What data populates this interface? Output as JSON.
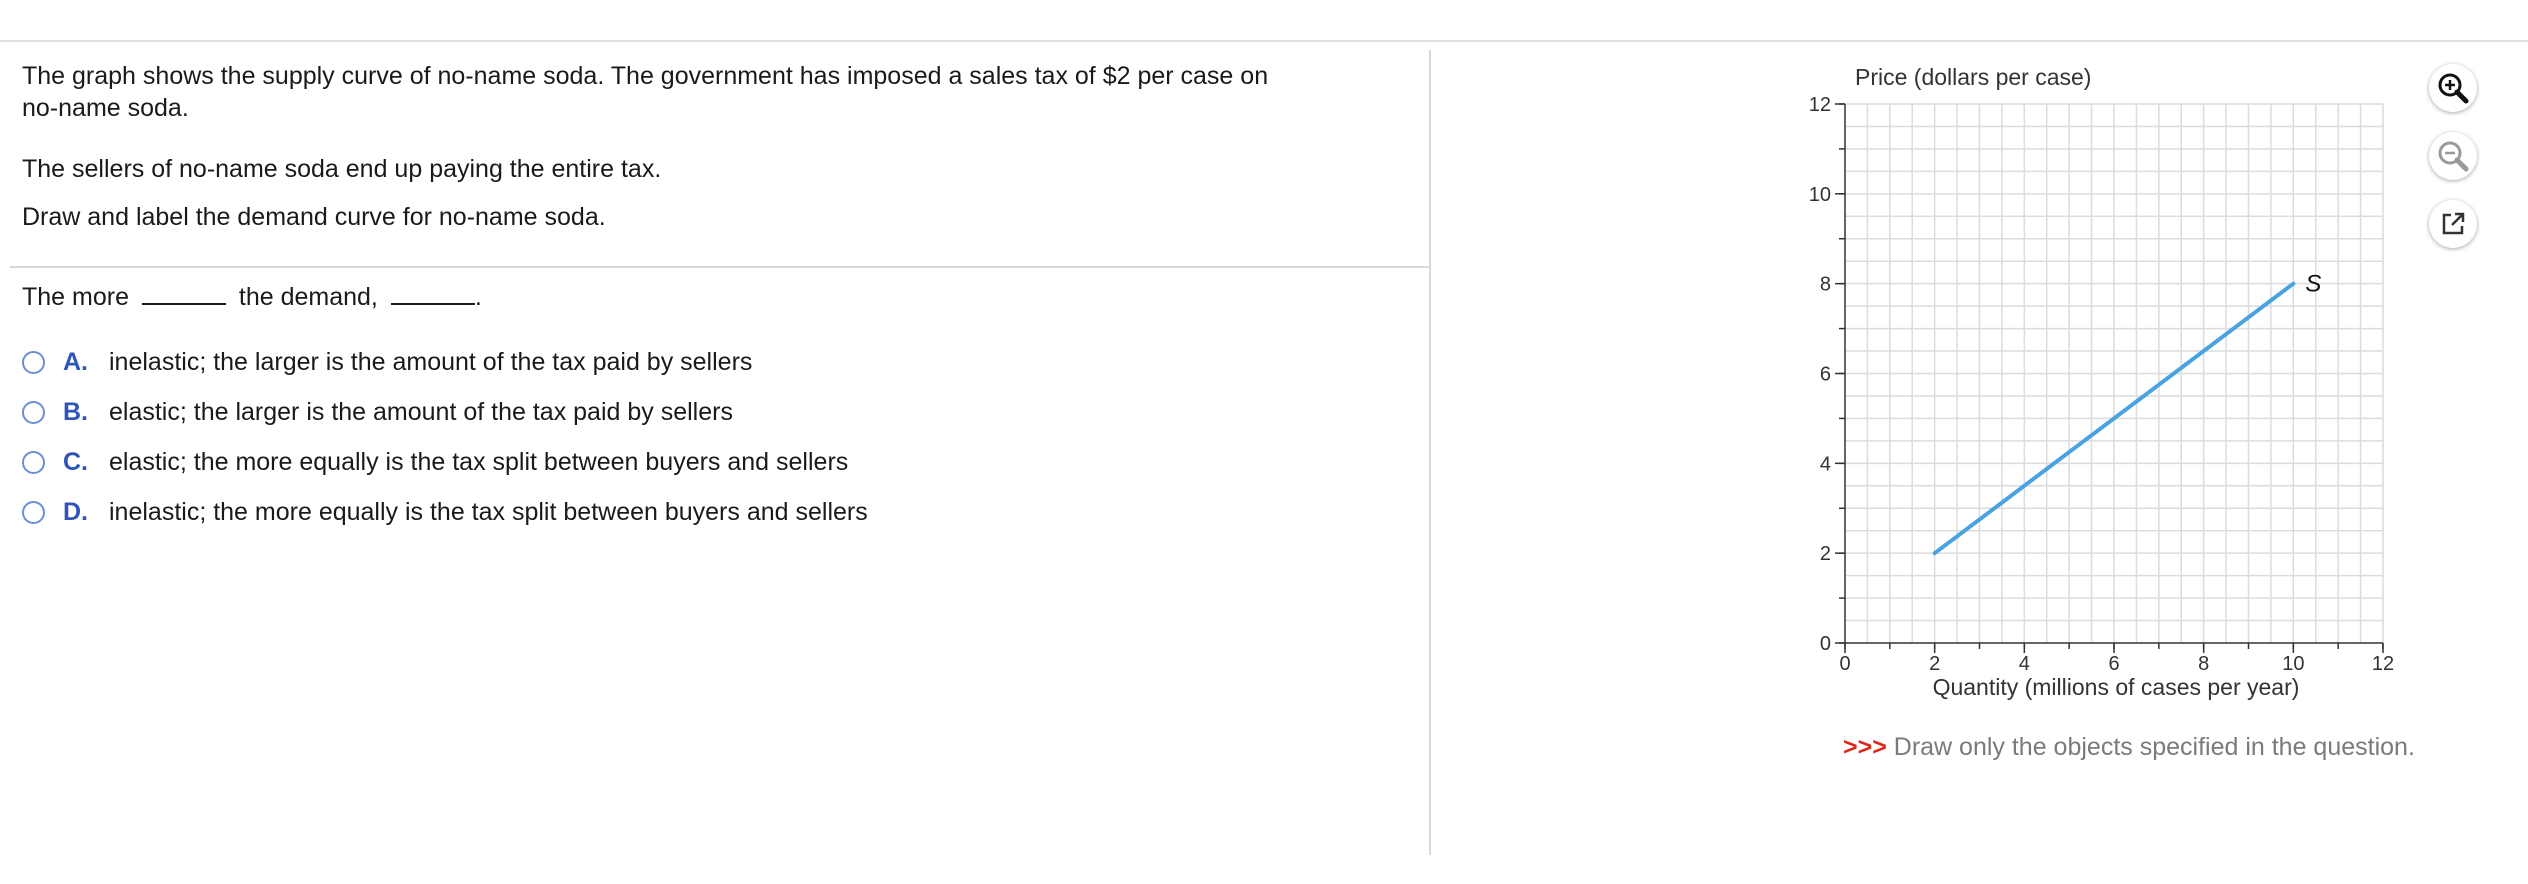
{
  "question": {
    "line1": "The graph shows the supply curve of no-name soda. The government has imposed a sales tax of $2 per case on",
    "line2": "no-name soda.",
    "line3": "The sellers of no-name soda end up paying the entire tax.",
    "line4": "Draw and label the demand curve for no-name soda."
  },
  "prompt": {
    "part1": "The more",
    "part2": "the demand,",
    "part3": "."
  },
  "options": [
    {
      "letter": "A.",
      "text": "inelastic; the larger is the amount of the tax paid by sellers"
    },
    {
      "letter": "B.",
      "text": "elastic; the larger is the amount of the tax paid by sellers"
    },
    {
      "letter": "C.",
      "text": "elastic; the more equally is the tax split between buyers and sellers"
    },
    {
      "letter": "D.",
      "text": "inelastic; the more equally is the tax split between buyers and sellers"
    }
  ],
  "tools": {
    "zoom_in_icon": "zoom-in-icon",
    "zoom_out_icon": "zoom-out-icon",
    "popout_icon": "external-link-icon"
  },
  "hint": {
    "arrows": ">>>",
    "text": " Draw only the objects specified in the question."
  },
  "colors": {
    "supply_line": "#4aa3df",
    "option_letter": "#2f55b8",
    "hint_arrows": "#d9291c"
  },
  "chart_data": {
    "type": "line",
    "ylabel": "Price (dollars per case)",
    "xlabel": "Quantity (millions of cases per year)",
    "xlim": [
      0,
      12
    ],
    "ylim": [
      0,
      12
    ],
    "x_ticks": [
      0,
      2,
      4,
      6,
      8,
      10,
      12
    ],
    "y_ticks": [
      0,
      2,
      4,
      6,
      8,
      10,
      12
    ],
    "grid": true,
    "series": [
      {
        "name": "S",
        "x": [
          2,
          10
        ],
        "y": [
          2,
          8
        ]
      }
    ]
  }
}
